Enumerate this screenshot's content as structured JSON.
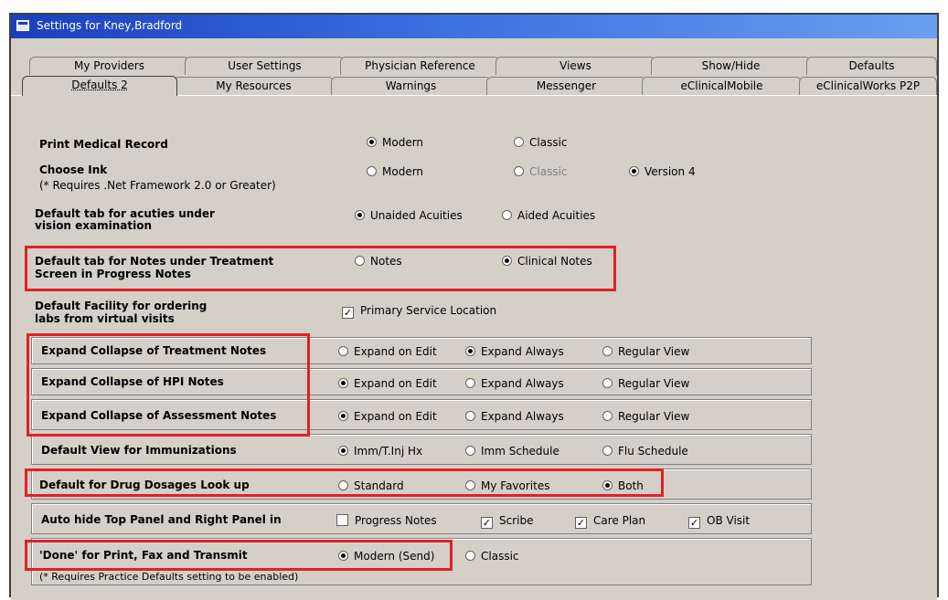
{
  "window": {
    "title": "Settings for Kney,Bradford"
  },
  "tabs_row1": [
    "My Providers",
    "User Settings",
    "Physician Reference",
    "Views",
    "Show/Hide",
    "Defaults"
  ],
  "tabs_row2": [
    "Defaults 2",
    "My Resources",
    "Warnings",
    "Messenger",
    "eClinicalMobile",
    "eClinicalWorks P2P"
  ],
  "settings": {
    "print_medical_record": {
      "label": "Print Medical Record",
      "opt1": "Modern",
      "opt2": "Classic",
      "selected": "Modern"
    },
    "choose_ink": {
      "label": "Choose Ink",
      "note": "(* Requires .Net Framework 2.0 or Greater)",
      "opt1": "Modern",
      "opt2": "Classic",
      "opt3": "Version 4",
      "selected": "Version 4"
    },
    "acuities": {
      "label_line1": "Default tab for acuties under",
      "label_line2": "vision examination",
      "opt1": "Unaided Acuities",
      "opt2": "Aided Acuities",
      "selected": "Unaided Acuities"
    },
    "notes_tab": {
      "label_line1": "Default tab for Notes under Treatment",
      "label_line2": "Screen in Progress Notes",
      "opt1": "Notes",
      "opt2": "Clinical Notes",
      "selected": "Clinical Notes"
    },
    "facility": {
      "label_line1": "Default Facility for ordering",
      "label_line2": "labs from virtual visits",
      "check_label": "Primary Service Location",
      "checked": true
    },
    "treatment_notes": {
      "label": "Expand Collapse of Treatment Notes",
      "opt1": "Expand on Edit",
      "opt2": "Expand Always",
      "opt3": "Regular View",
      "selected": "Expand Always"
    },
    "hpi_notes": {
      "label": "Expand Collapse of HPI Notes",
      "opt1": "Expand on Edit",
      "opt2": "Expand Always",
      "opt3": "Regular View",
      "selected": "Expand on Edit"
    },
    "assessment_notes": {
      "label": "Expand Collapse of Assessment Notes",
      "opt1": "Expand on Edit",
      "opt2": "Expand Always",
      "opt3": "Regular View",
      "selected": "Expand on Edit"
    },
    "immunizations": {
      "label": "Default View for Immunizations",
      "opt1": "Imm/T.Inj Hx",
      "opt2": "Imm Schedule",
      "opt3": "Flu Schedule",
      "selected": "Imm/T.Inj Hx"
    },
    "drug_dosages": {
      "label": "Default for Drug Dosages Look up",
      "opt1": "Standard",
      "opt2": "My Favorites",
      "opt3": "Both",
      "selected": "Both"
    },
    "auto_hide": {
      "label": "Auto hide Top Panel and Right Panel in",
      "c1": "Progress Notes",
      "c2": "Scribe",
      "c3": "Care Plan",
      "c4": "OB Visit",
      "checked": [
        "Scribe",
        "Care Plan",
        "OB Visit"
      ]
    },
    "done": {
      "label": "'Done' for Print, Fax and Transmit",
      "note": "(* Requires Practice Defaults setting to be enabled)",
      "opt1": "Modern (Send)",
      "opt2": "Classic",
      "selected": "Modern (Send)"
    }
  },
  "check_mark": "✓",
  "colors": {
    "highlight": "#e0202a",
    "titlebar": "#1a3fbf",
    "panel": "#d4d0c8"
  }
}
